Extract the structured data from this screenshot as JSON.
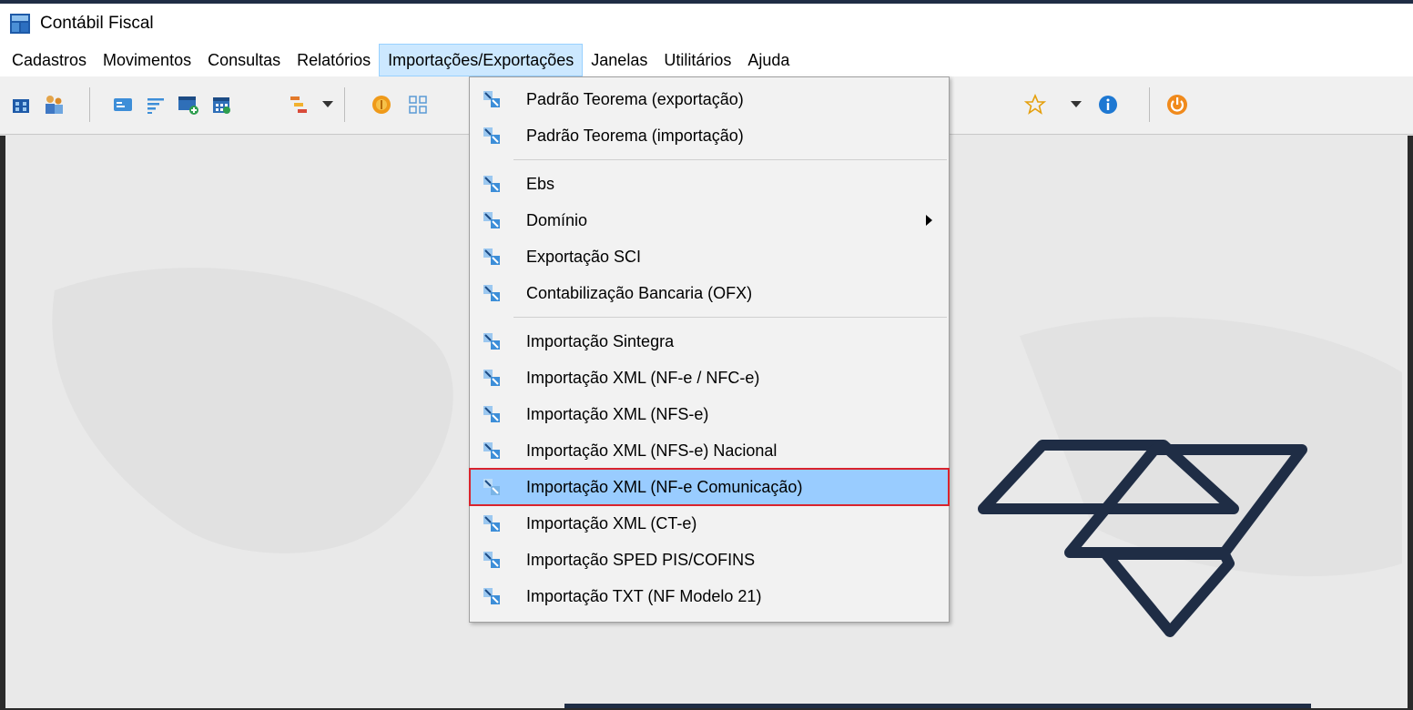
{
  "window": {
    "title": "Contábil Fiscal"
  },
  "menubar": {
    "items": [
      {
        "label": "Cadastros"
      },
      {
        "label": "Movimentos"
      },
      {
        "label": "Consultas"
      },
      {
        "label": "Relatórios"
      },
      {
        "label": "Importações/Exportações",
        "active": true
      },
      {
        "label": "Janelas"
      },
      {
        "label": "Utilitários"
      },
      {
        "label": "Ajuda"
      }
    ]
  },
  "toolbar": {
    "icons": [
      "company-icon",
      "users-icon",
      "card-icon",
      "filter-list-icon",
      "window-add-icon",
      "calendar-icon",
      "hierarchy-icon",
      "coin-icon",
      "grid-icon",
      "star-icon",
      "info-icon",
      "power-icon"
    ]
  },
  "dropdown": {
    "items": [
      {
        "label": "Padrão Teorema (exportação)"
      },
      {
        "label": "Padrão Teorema (importação)"
      },
      {
        "label": "Ebs"
      },
      {
        "label": "Domínio",
        "submenu": true
      },
      {
        "label": "Exportação SCI"
      },
      {
        "label": "Contabilização Bancaria (OFX)"
      },
      {
        "label": "Importação Sintegra"
      },
      {
        "label": "Importação XML (NF-e / NFC-e)"
      },
      {
        "label": "Importação XML (NFS-e)"
      },
      {
        "label": "Importação XML (NFS-e) Nacional"
      },
      {
        "label": "Importação XML (NF-e Comunicação)",
        "highlighted": true
      },
      {
        "label": "Importação XML (CT-e)"
      },
      {
        "label": "Importação SPED PIS/COFINS"
      },
      {
        "label": "Importação TXT (NF Modelo 21)"
      }
    ]
  },
  "colors": {
    "menu_active": "#cce8ff",
    "highlight": "#99ccff",
    "highlight_border": "#d9232d",
    "brand": "#1f2d45"
  }
}
